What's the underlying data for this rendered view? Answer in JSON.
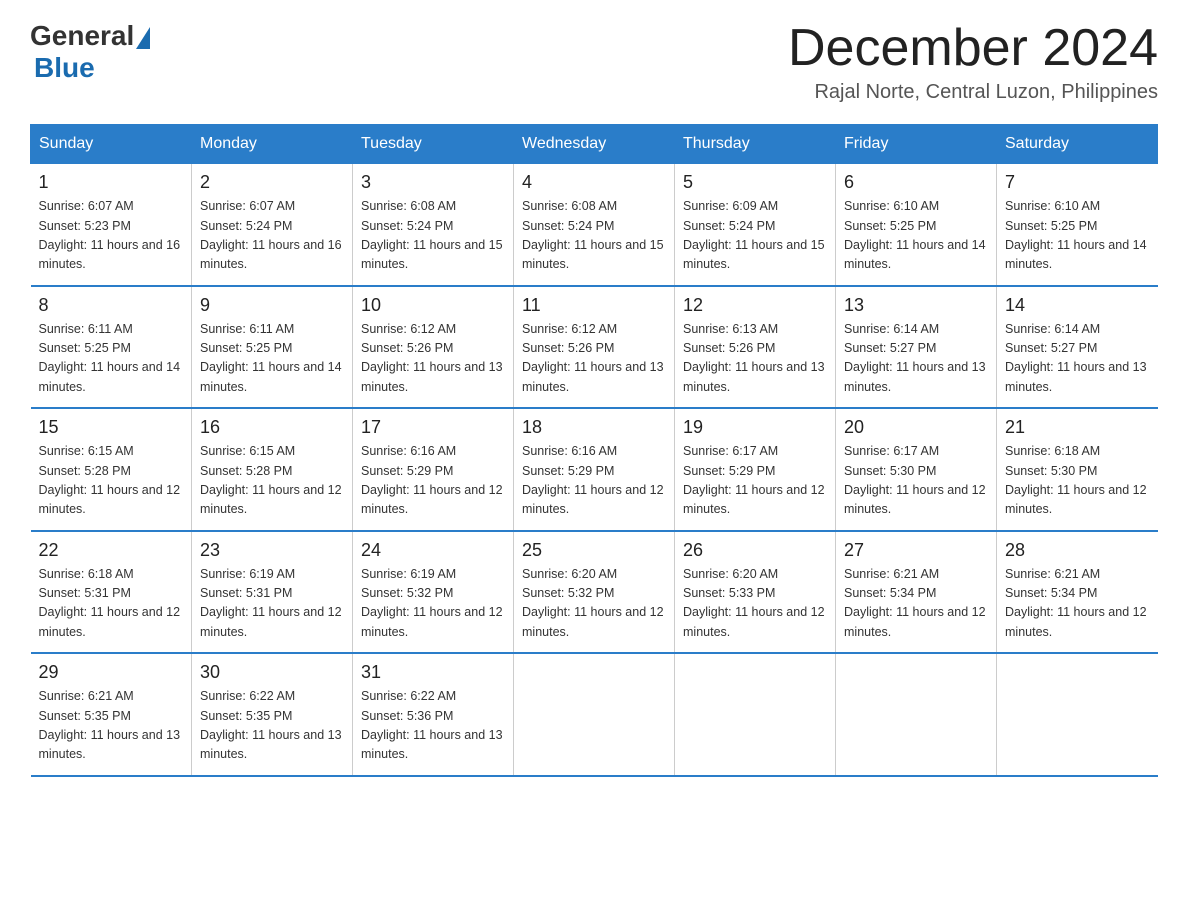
{
  "header": {
    "logo_general": "General",
    "logo_blue": "Blue",
    "month_title": "December 2024",
    "location": "Rajal Norte, Central Luzon, Philippines"
  },
  "days_of_week": [
    "Sunday",
    "Monday",
    "Tuesday",
    "Wednesday",
    "Thursday",
    "Friday",
    "Saturday"
  ],
  "weeks": [
    [
      {
        "day": "1",
        "sunrise": "6:07 AM",
        "sunset": "5:23 PM",
        "daylight": "11 hours and 16 minutes."
      },
      {
        "day": "2",
        "sunrise": "6:07 AM",
        "sunset": "5:24 PM",
        "daylight": "11 hours and 16 minutes."
      },
      {
        "day": "3",
        "sunrise": "6:08 AM",
        "sunset": "5:24 PM",
        "daylight": "11 hours and 15 minutes."
      },
      {
        "day": "4",
        "sunrise": "6:08 AM",
        "sunset": "5:24 PM",
        "daylight": "11 hours and 15 minutes."
      },
      {
        "day": "5",
        "sunrise": "6:09 AM",
        "sunset": "5:24 PM",
        "daylight": "11 hours and 15 minutes."
      },
      {
        "day": "6",
        "sunrise": "6:10 AM",
        "sunset": "5:25 PM",
        "daylight": "11 hours and 14 minutes."
      },
      {
        "day": "7",
        "sunrise": "6:10 AM",
        "sunset": "5:25 PM",
        "daylight": "11 hours and 14 minutes."
      }
    ],
    [
      {
        "day": "8",
        "sunrise": "6:11 AM",
        "sunset": "5:25 PM",
        "daylight": "11 hours and 14 minutes."
      },
      {
        "day": "9",
        "sunrise": "6:11 AM",
        "sunset": "5:25 PM",
        "daylight": "11 hours and 14 minutes."
      },
      {
        "day": "10",
        "sunrise": "6:12 AM",
        "sunset": "5:26 PM",
        "daylight": "11 hours and 13 minutes."
      },
      {
        "day": "11",
        "sunrise": "6:12 AM",
        "sunset": "5:26 PM",
        "daylight": "11 hours and 13 minutes."
      },
      {
        "day": "12",
        "sunrise": "6:13 AM",
        "sunset": "5:26 PM",
        "daylight": "11 hours and 13 minutes."
      },
      {
        "day": "13",
        "sunrise": "6:14 AM",
        "sunset": "5:27 PM",
        "daylight": "11 hours and 13 minutes."
      },
      {
        "day": "14",
        "sunrise": "6:14 AM",
        "sunset": "5:27 PM",
        "daylight": "11 hours and 13 minutes."
      }
    ],
    [
      {
        "day": "15",
        "sunrise": "6:15 AM",
        "sunset": "5:28 PM",
        "daylight": "11 hours and 12 minutes."
      },
      {
        "day": "16",
        "sunrise": "6:15 AM",
        "sunset": "5:28 PM",
        "daylight": "11 hours and 12 minutes."
      },
      {
        "day": "17",
        "sunrise": "6:16 AM",
        "sunset": "5:29 PM",
        "daylight": "11 hours and 12 minutes."
      },
      {
        "day": "18",
        "sunrise": "6:16 AM",
        "sunset": "5:29 PM",
        "daylight": "11 hours and 12 minutes."
      },
      {
        "day": "19",
        "sunrise": "6:17 AM",
        "sunset": "5:29 PM",
        "daylight": "11 hours and 12 minutes."
      },
      {
        "day": "20",
        "sunrise": "6:17 AM",
        "sunset": "5:30 PM",
        "daylight": "11 hours and 12 minutes."
      },
      {
        "day": "21",
        "sunrise": "6:18 AM",
        "sunset": "5:30 PM",
        "daylight": "11 hours and 12 minutes."
      }
    ],
    [
      {
        "day": "22",
        "sunrise": "6:18 AM",
        "sunset": "5:31 PM",
        "daylight": "11 hours and 12 minutes."
      },
      {
        "day": "23",
        "sunrise": "6:19 AM",
        "sunset": "5:31 PM",
        "daylight": "11 hours and 12 minutes."
      },
      {
        "day": "24",
        "sunrise": "6:19 AM",
        "sunset": "5:32 PM",
        "daylight": "11 hours and 12 minutes."
      },
      {
        "day": "25",
        "sunrise": "6:20 AM",
        "sunset": "5:32 PM",
        "daylight": "11 hours and 12 minutes."
      },
      {
        "day": "26",
        "sunrise": "6:20 AM",
        "sunset": "5:33 PM",
        "daylight": "11 hours and 12 minutes."
      },
      {
        "day": "27",
        "sunrise": "6:21 AM",
        "sunset": "5:34 PM",
        "daylight": "11 hours and 12 minutes."
      },
      {
        "day": "28",
        "sunrise": "6:21 AM",
        "sunset": "5:34 PM",
        "daylight": "11 hours and 12 minutes."
      }
    ],
    [
      {
        "day": "29",
        "sunrise": "6:21 AM",
        "sunset": "5:35 PM",
        "daylight": "11 hours and 13 minutes."
      },
      {
        "day": "30",
        "sunrise": "6:22 AM",
        "sunset": "5:35 PM",
        "daylight": "11 hours and 13 minutes."
      },
      {
        "day": "31",
        "sunrise": "6:22 AM",
        "sunset": "5:36 PM",
        "daylight": "11 hours and 13 minutes."
      },
      null,
      null,
      null,
      null
    ]
  ],
  "labels": {
    "sunrise_prefix": "Sunrise: ",
    "sunset_prefix": "Sunset: ",
    "daylight_prefix": "Daylight: "
  }
}
